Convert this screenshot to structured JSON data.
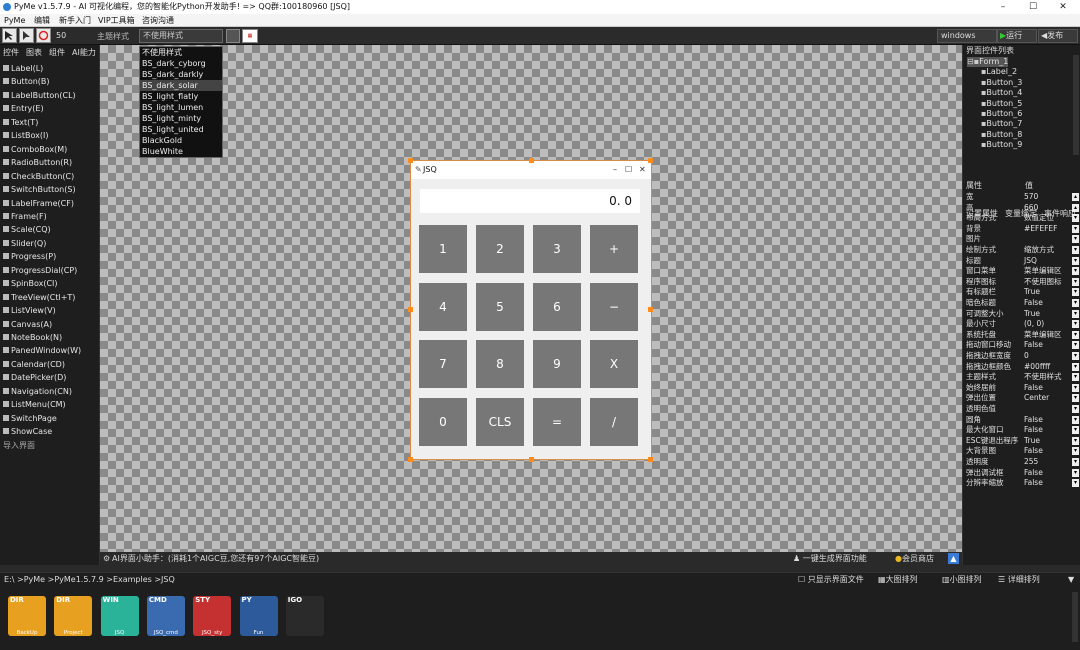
{
  "window": {
    "title": "PyMe v1.5.7.9 - AI 可视化编程，您的智能化Python开发助手!   => QQ群:100180960   [JSQ]",
    "min": "–",
    "max": "☐",
    "close": "✕"
  },
  "menu": [
    "PyMe",
    "编辑",
    "新手入门",
    "VIP工具箱",
    "咨询沟通"
  ],
  "toolbar": {
    "zoom": "50",
    "theme_label": "主题样式",
    "theme_value": "不使用样式",
    "platform": "windows",
    "run": "运行",
    "publish": "发布"
  },
  "theme_options": [
    "不使用样式",
    "BS_dark_cyborg",
    "BS_dark_darkly",
    "BS_dark_solar",
    "BS_light_flatly",
    "BS_light_lumen",
    "BS_light_minty",
    "BS_light_united",
    "BlackGold",
    "BlueWhite"
  ],
  "left_tabs": [
    "控件",
    "图表",
    "组件",
    "AI能力"
  ],
  "components": [
    "Label(L)",
    "Button(B)",
    "LabelButton(CL)",
    "Entry(E)",
    "Text(T)",
    "ListBox(I)",
    "ComboBox(M)",
    "RadioButton(R)",
    "CheckButton(C)",
    "SwitchButton(S)",
    "LabelFrame(CF)",
    "Frame(F)",
    "Scale(CQ)",
    "Slider(Q)",
    "Progress(P)",
    "ProgressDial(CP)",
    "SpinBox(CI)",
    "TreeView(Ctl+T)",
    "ListView(V)",
    "Canvas(A)",
    "NoteBook(N)",
    "PanedWindow(W)",
    "Calendar(CD)",
    "DatePicker(D)",
    "Navigation(CN)",
    "ListMenu(CM)",
    "SwitchPage",
    "ShowCase",
    "导入界面"
  ],
  "form": {
    "title": "JSQ",
    "display": "0. 0",
    "keys": [
      "1",
      "2",
      "3",
      "+",
      "4",
      "5",
      "6",
      "−",
      "7",
      "8",
      "9",
      "X",
      "0",
      "CLS",
      "=",
      "/"
    ]
  },
  "right": {
    "tree_title": "界面控件列表",
    "tree": [
      "Form_1",
      "Label_2",
      "Button_3",
      "Button_4",
      "Button_5",
      "Button_6",
      "Button_7",
      "Button_8",
      "Button_9"
    ],
    "prop_tabs": [
      "设置属性",
      "变量绑定",
      "事件响应"
    ],
    "prop_header": [
      "属性",
      "值"
    ],
    "props": [
      [
        "宽",
        "570"
      ],
      [
        "高",
        "660"
      ],
      [
        "布局方式",
        "数值定位"
      ],
      [
        "背景",
        "#EFEFEF"
      ],
      [
        "图片",
        ""
      ],
      [
        "绘制方式",
        "缩放方式"
      ],
      [
        "标题",
        "JSQ"
      ],
      [
        "窗口菜单",
        "菜单编辑区"
      ],
      [
        "程序图标",
        "不使用图标"
      ],
      [
        "有标题栏",
        "True"
      ],
      [
        "暗色标题",
        "False"
      ],
      [
        "可调整大小",
        "True"
      ],
      [
        "最小尺寸",
        "(0, 0)"
      ],
      [
        "系统托盘",
        "菜单编辑区"
      ],
      [
        "拖动窗口移动",
        "False"
      ],
      [
        "拖拽边框宽度",
        "0"
      ],
      [
        "拖拽边框颜色",
        "#00ffff"
      ],
      [
        "主题样式",
        "不使用样式"
      ],
      [
        "始终居前",
        "False"
      ],
      [
        "弹出位置",
        "Center"
      ],
      [
        "透明色值",
        ""
      ],
      [
        "圆角",
        "False"
      ],
      [
        "最大化窗口",
        "False"
      ],
      [
        "ESC键退出程序",
        "True"
      ],
      [
        "大背景图",
        "False"
      ],
      [
        "透明度",
        "255"
      ],
      [
        "弹出调试框",
        "False"
      ],
      [
        "分辨率缩放",
        "False"
      ]
    ]
  },
  "ai": {
    "text": "AI界面小助手：(消耗1个AIGC豆,您还有97个AIGC智能豆)",
    "gen": "一键生成界面功能",
    "store": "会员商店"
  },
  "path": {
    "text": "E:\\ >PyMe >PyMe1.5.7.9 >Examples >JSQ",
    "only": "只显示界面文件",
    "big": "大图排列",
    "small": "小图排列",
    "detail": "详细排列"
  },
  "files": [
    {
      "type": "DIR",
      "name": "BackUp"
    },
    {
      "type": "DIR",
      "name": "Project"
    },
    {
      "type": "WIN",
      "name": "JSQ"
    },
    {
      "type": "CMD",
      "name": "JSQ_cmd"
    },
    {
      "type": "STY",
      "name": "JSQ_sty"
    },
    {
      "type": "PY",
      "name": "Fun"
    },
    {
      "type": "IGO",
      "name": ""
    }
  ],
  "colors": {
    "accent": "#ff8c1a",
    "key": "#777777",
    "form_bg": "#EFEFEF"
  }
}
